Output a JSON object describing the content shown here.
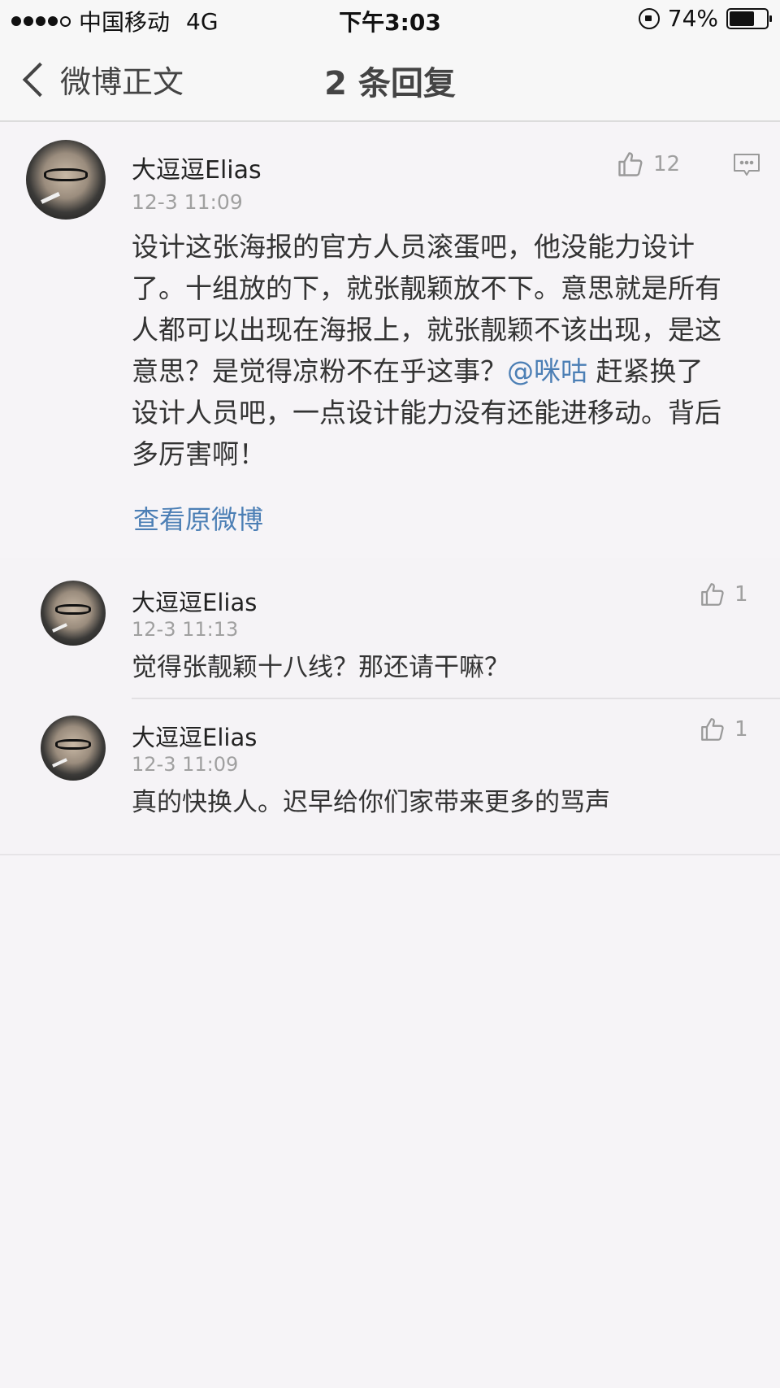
{
  "status_bar": {
    "carrier": "中国移动",
    "network": "4G",
    "time": "下午3:03",
    "battery": "74%",
    "battery_level": 0.74,
    "icons": [
      "signal-dots",
      "rotation-lock-icon",
      "battery-icon"
    ]
  },
  "nav": {
    "back_label": "微博正文",
    "title": "2 条回复"
  },
  "main_comment": {
    "user": "大逗逗Elias",
    "time": "12-3 11:09",
    "likes": "12",
    "text_lines": [
      "设计这张海报的官方人员滚蛋吧，他没能力设计",
      "了。十组放的下，就张靓颖放不下。意思就是所有",
      "人都可以出现在海报上，就张靓颖不该出现，是这"
    ],
    "line4_before": "意思？是觉得凉粉不在乎这事？",
    "mention": "@咪咕",
    "line4_after": " 赶紧换了",
    "text_lines_tail": [
      "设计人员吧，一点设计能力没有还能进移动。背后",
      "多厉害啊！"
    ],
    "view_original": "查看原微博"
  },
  "replies": [
    {
      "user": "大逗逗Elias",
      "time": "12-3 11:13",
      "likes": "1",
      "text": "觉得张靓颖十八线？那还请干嘛？"
    },
    {
      "user": "大逗逗Elias",
      "time": "12-3 11:09",
      "likes": "1",
      "text": "真的快换人。迟早给你们家带来更多的骂声"
    }
  ],
  "colors": {
    "link": "#4c7fb5",
    "background": "#f6f4f7",
    "muted": "#a0a0a0"
  }
}
